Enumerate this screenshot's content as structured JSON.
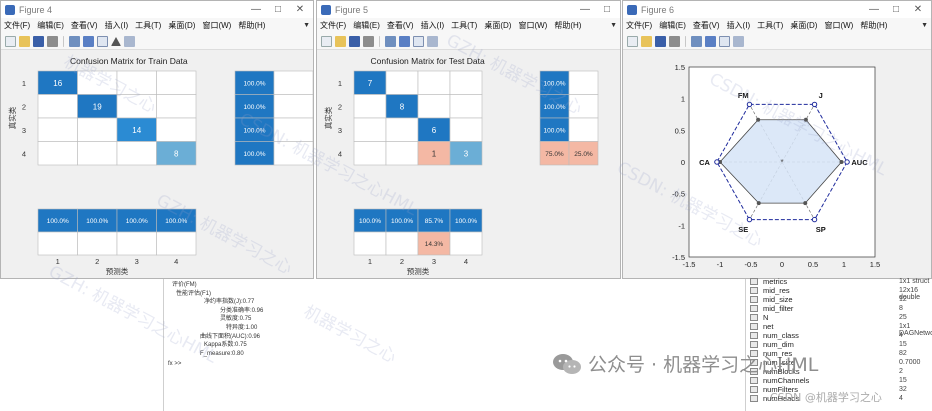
{
  "menu": [
    "文件(F)",
    "编辑(E)",
    "查看(V)",
    "插入(I)",
    "工具(T)",
    "桌面(D)",
    "窗口(W)",
    "帮助(H)"
  ],
  "windows": [
    {
      "title": "Figure 4"
    },
    {
      "title": "Figure 5"
    },
    {
      "title": "Figure 6"
    }
  ],
  "controls": {
    "minimize": "—",
    "maximize": "□",
    "close": "✕"
  },
  "colors": {
    "dark_blue": "#1f77c2",
    "light_blue": "#6baed6",
    "salmon": "#f4b8a4",
    "radar_fill": "#d6e4f7",
    "radar_line": "#1e2a9c"
  },
  "chart_data": [
    {
      "type": "heatmap",
      "title": "Confusion Matrix for Train Data",
      "ylabel": "真实类",
      "xlabel": "预测类",
      "row_labels": [
        "1",
        "2",
        "3",
        "4"
      ],
      "col_labels": [
        "1",
        "2",
        "3",
        "4"
      ],
      "cells": [
        [
          "16",
          "",
          "",
          ""
        ],
        [
          "",
          "19",
          "",
          ""
        ],
        [
          "",
          "",
          "14",
          ""
        ],
        [
          "",
          "",
          "",
          "8"
        ]
      ],
      "row_summary": [
        [
          "100.0%",
          ""
        ],
        [
          "100.0%",
          ""
        ],
        [
          "100.0%",
          ""
        ],
        [
          "100.0%",
          ""
        ]
      ],
      "col_summary": [
        [
          "100.0%",
          "100.0%",
          "100.0%",
          "100.0%"
        ],
        [
          "",
          "",
          "",
          ""
        ]
      ]
    },
    {
      "type": "heatmap",
      "title": "Confusion Matrix for Test Data",
      "ylabel": "真实类",
      "xlabel": "预测类",
      "row_labels": [
        "1",
        "2",
        "3",
        "4"
      ],
      "col_labels": [
        "1",
        "2",
        "3",
        "4"
      ],
      "cells": [
        [
          "7",
          "",
          "",
          ""
        ],
        [
          "",
          "8",
          "",
          ""
        ],
        [
          "",
          "",
          "6",
          ""
        ],
        [
          "",
          "",
          "1",
          "3"
        ]
      ],
      "row_summary": [
        [
          "100.0%",
          ""
        ],
        [
          "100.0%",
          ""
        ],
        [
          "100.0%",
          ""
        ],
        [
          "75.0%",
          "25.0%"
        ]
      ],
      "col_summary": [
        [
          "100.0%",
          "100.0%",
          "85.7%",
          "100.0%"
        ],
        [
          "",
          "",
          "14.3%",
          ""
        ]
      ]
    },
    {
      "type": "radar",
      "axes": [
        "J",
        "AUC",
        "SP",
        "SE",
        "CA",
        "FM"
      ],
      "values": [
        0.77,
        0.96,
        0.75,
        0.75,
        1.0,
        0.77
      ],
      "outer_ring": 1.0,
      "xlim": [
        -1.5,
        1.5
      ],
      "ylim": [
        -1.5,
        1.5
      ],
      "xticks": [
        "-1.5",
        "-1",
        "-0.5",
        "0",
        "0.5",
        "1",
        "1.5"
      ],
      "yticks": [
        "1.5",
        "1",
        "0.5",
        "0",
        "-0.5",
        "-1",
        "-1.5"
      ]
    }
  ],
  "command": {
    "lines": [
      "评价(FM)",
      "性能评估(F1)",
      "净约率指数(J):0.77",
      "分类准确率:0.96",
      "灵敏度:0.75",
      "特异度:1.00",
      "曲线下面积(AUC):0.96",
      "Kappa系数:0.75",
      "F_measure:0.80"
    ],
    "prompt": "fx >>"
  },
  "workspace": [
    {
      "name": "metrics",
      "value": "1x1 struct"
    },
    {
      "name": "mid_res",
      "value": "12x16 double"
    },
    {
      "name": "mid_size",
      "value": "12"
    },
    {
      "name": "mid_filter",
      "value": "8"
    },
    {
      "name": "N",
      "value": "25"
    },
    {
      "name": "net",
      "value": "1x1 DAGNetwork"
    },
    {
      "name": "num_class",
      "value": "4"
    },
    {
      "name": "num_dim",
      "value": "15"
    },
    {
      "name": "num_res",
      "value": "82"
    },
    {
      "name": "num_size",
      "value": "0.7000"
    },
    {
      "name": "numBlocks",
      "value": "2"
    },
    {
      "name": "numChannels",
      "value": "15"
    },
    {
      "name": "numFilters",
      "value": "32"
    },
    {
      "name": "numHeads",
      "value": "4"
    }
  ],
  "branding": {
    "account": "公众号 · 机器学习之心HML",
    "credit": "CSDN @机器学习之心"
  },
  "watermarks": [
    "机器学习之心",
    "CSDN: 机器学习之心HML",
    "GZH: 机器学习之心",
    "CSDN: 机器学习之心",
    "GZH: 机器学习之心HML",
    "机器学习之心",
    "CSDN: 机器学习之心HML",
    "GZH: 机器学习之心"
  ]
}
